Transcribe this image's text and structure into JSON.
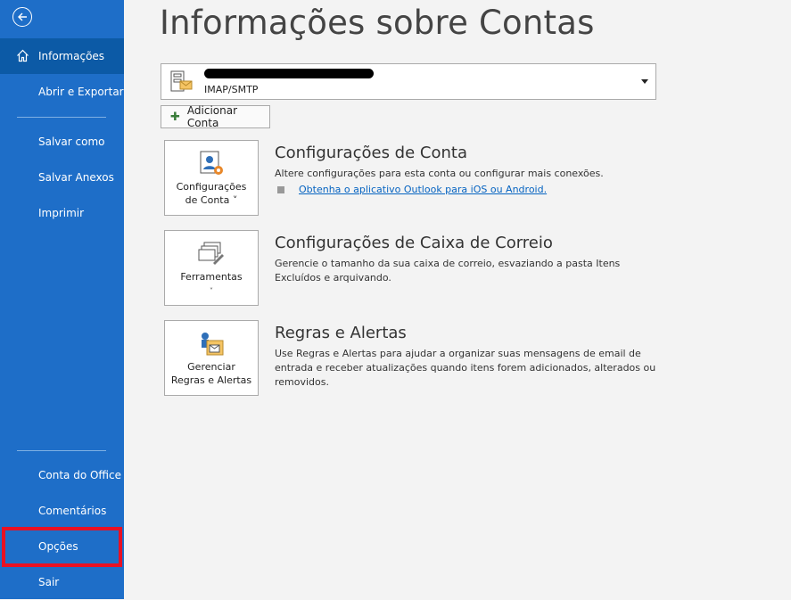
{
  "sidebar": {
    "back_icon": "back-arrow-icon",
    "items": [
      {
        "label": "Informações",
        "icon": "home-icon"
      },
      {
        "label": "Abrir e Exportar"
      },
      {
        "label": "Salvar como"
      },
      {
        "label": "Salvar Anexos"
      },
      {
        "label": "Imprimir"
      },
      {
        "label": "Conta do Office"
      },
      {
        "label": "Comentários"
      },
      {
        "label": "Opções"
      },
      {
        "label": "Sair"
      }
    ],
    "highlight_color": "#e81123",
    "background": "#1e6ec8",
    "active_background": "#0c5aa6"
  },
  "main": {
    "title": "Informações sobre Contas",
    "account": {
      "type": "IMAP/SMTP"
    },
    "add_account_label": "Adicionar Conta",
    "sections": [
      {
        "button_line1": "Configurações",
        "button_line2": "de Conta ˅",
        "title": "Configurações de Conta",
        "description": "Altere configurações para esta conta ou configurar mais conexões.",
        "link": "Obtenha o aplicativo Outlook para iOS ou Android."
      },
      {
        "button_line1": "Ferramentas",
        "button_line2": "˅",
        "title": "Configurações de Caixa de Correio",
        "description": "Gerencie o tamanho da sua caixa de correio, esvaziando a pasta Itens Excluídos e arquivando."
      },
      {
        "button_line1": "Gerenciar",
        "button_line2": "Regras e Alertas",
        "title": "Regras e Alertas",
        "description": "Use Regras e Alertas para ajudar a organizar suas mensagens de email de entrada e receber atualizações quando itens forem adicionados, alterados ou removidos."
      }
    ]
  }
}
